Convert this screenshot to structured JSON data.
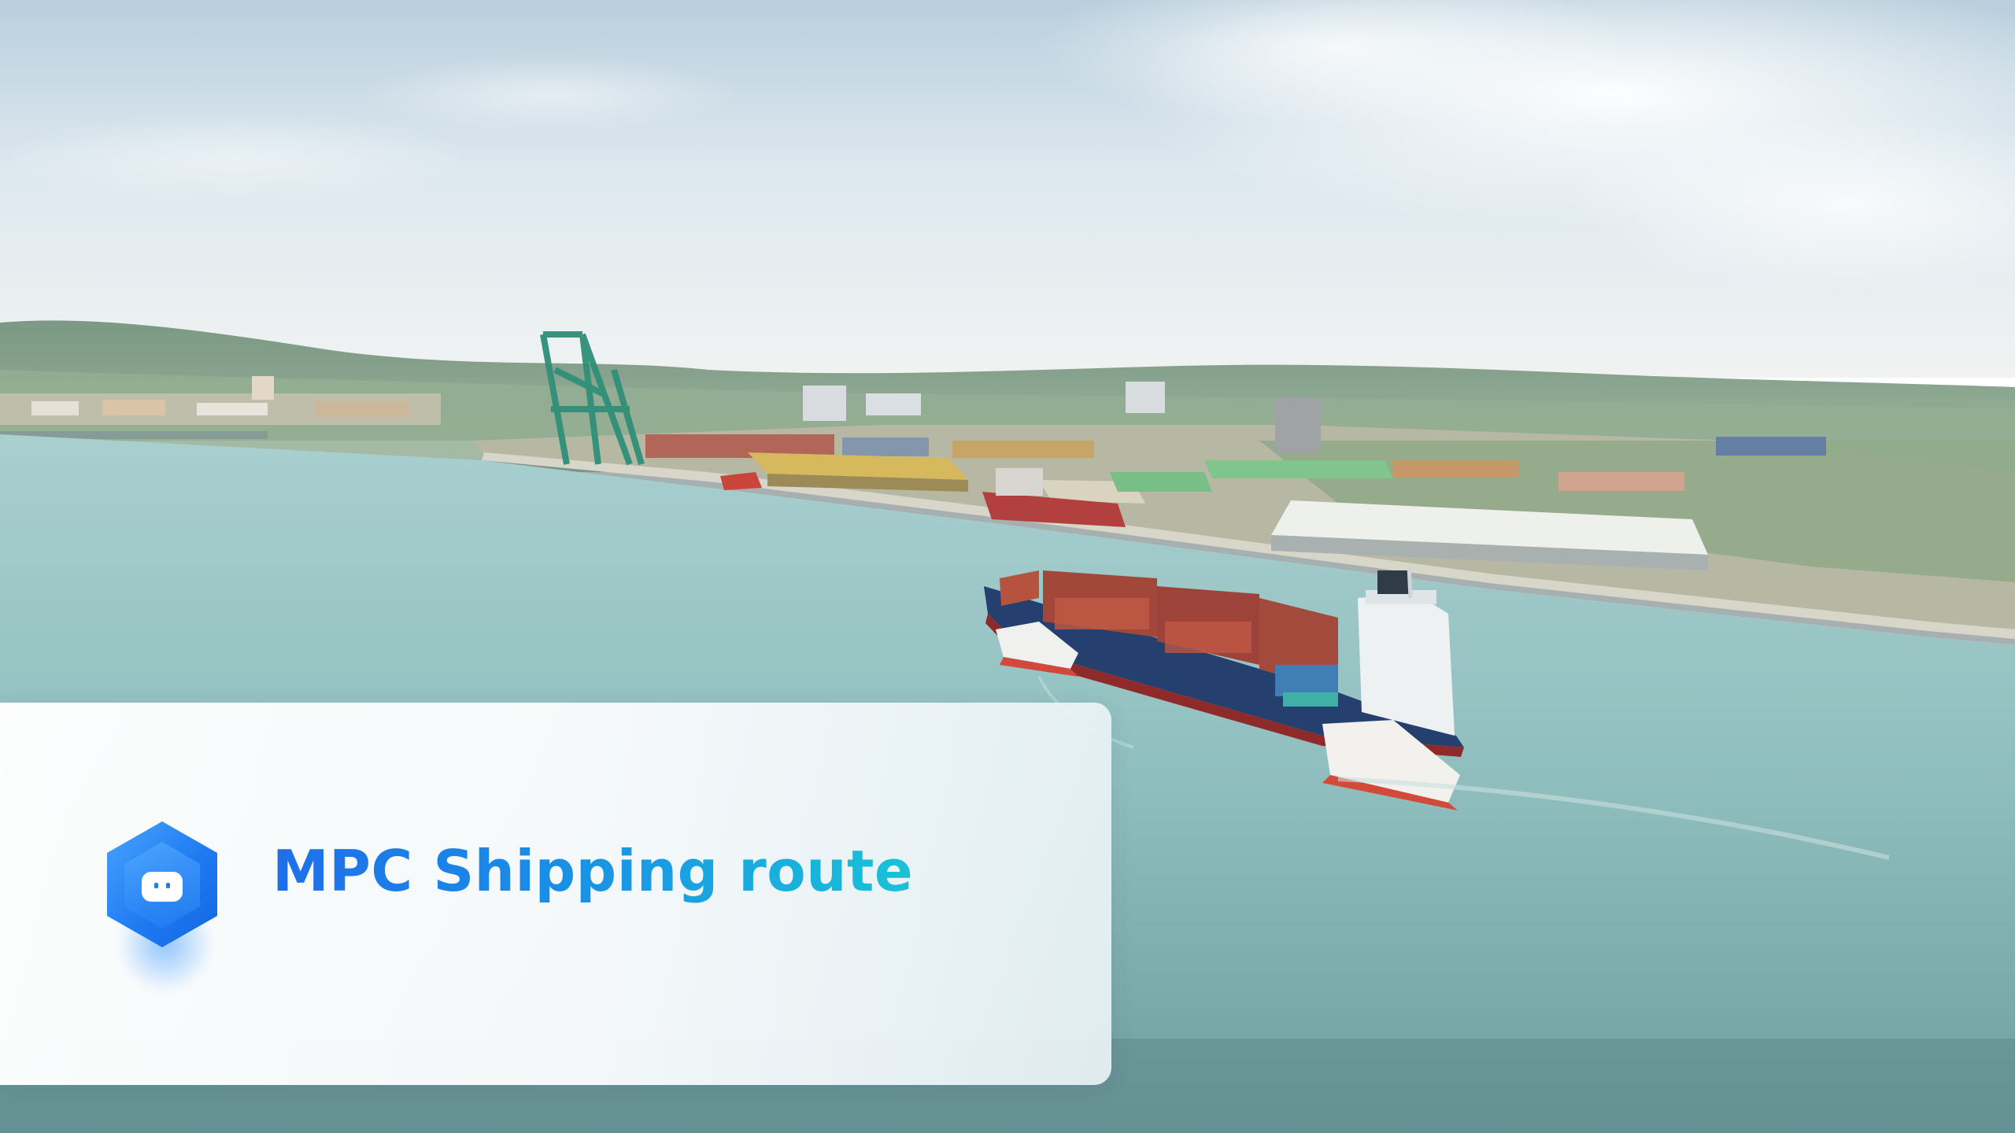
{
  "banner": {
    "title": "MPC Shipping route",
    "badge_icon": "chat-bot-icon",
    "accent_start": "#1f6fe8",
    "accent_end": "#19c2d8"
  },
  "background": {
    "description_icon": "port-aerial-photo"
  }
}
